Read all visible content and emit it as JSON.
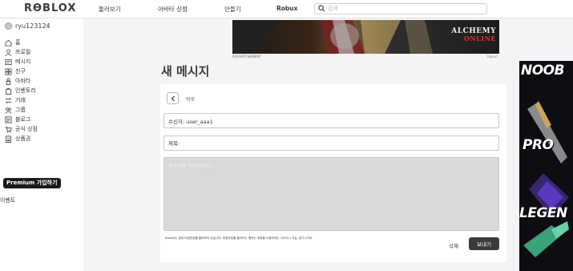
{
  "topbar": {
    "logo": "RƟBLOX",
    "nav": [
      "둘러보기",
      "아바타 상점",
      "만들기",
      "Robux"
    ],
    "search_placeholder": "검색"
  },
  "sidebar": {
    "username": "ryu123124",
    "items": [
      {
        "label": "홈",
        "icon": "home-icon"
      },
      {
        "label": "프로필",
        "icon": "profile-icon"
      },
      {
        "label": "메시지",
        "icon": "messages-icon"
      },
      {
        "label": "친구",
        "icon": "friends-icon"
      },
      {
        "label": "아바타",
        "icon": "avatar-icon"
      },
      {
        "label": "인벤토리",
        "icon": "inventory-icon"
      },
      {
        "label": "거래",
        "icon": "trade-icon"
      },
      {
        "label": "그룹",
        "icon": "groups-icon"
      },
      {
        "label": "블로그",
        "icon": "blog-icon"
      },
      {
        "label": "공식 상점",
        "icon": "shop-icon"
      },
      {
        "label": "상품권",
        "icon": "gift-card-icon"
      }
    ],
    "premium_label": "Premium 가입하기",
    "events_label": "이벤트"
  },
  "ad": {
    "label": "ADVERTISEMENT",
    "report": "Report",
    "title_line1": "ALCHEMY",
    "title_line2": "ONLINE"
  },
  "page": {
    "title": "새 메시지"
  },
  "compose": {
    "back_label": "뒤로",
    "recipient_value": "수신자: user_aaa1",
    "subject_placeholder": "제목:",
    "body_placeholder": "메시지를 작성하세요...",
    "footer_note": "Roblox는 절대 비밀번호를 물어보지 않습니다. 비밀번호를 물어보는 행위는 계정을 도용하려는 시도이니 사실, 알기시기바.",
    "delete_label": "삭제",
    "send_label": "보내기"
  },
  "right_ad": {
    "words": [
      "NOOB",
      "PRO",
      "LEGEN"
    ]
  }
}
